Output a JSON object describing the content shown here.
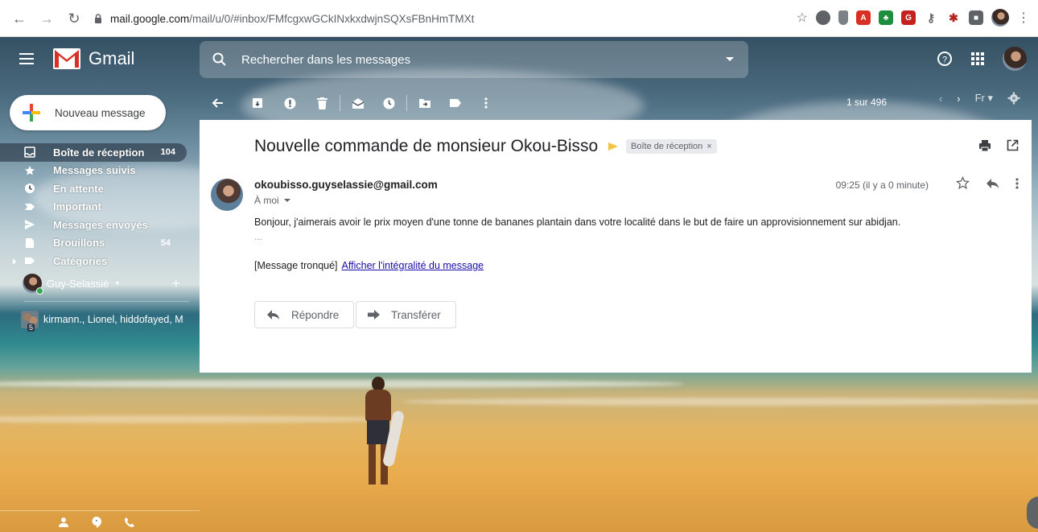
{
  "browser": {
    "url_host": "mail.google.com",
    "url_path": "/mail/u/0/#inbox/FMfcgxwGCkINxkxdwjnSQXsFBnHmTMXt"
  },
  "gmail": {
    "logo_text": "Gmail",
    "search_placeholder": "Rechercher dans les messages"
  },
  "sidebar": {
    "compose_label": "Nouveau message",
    "items": [
      {
        "label": "Boîte de réception",
        "count": "104",
        "icon": "inbox-icon"
      },
      {
        "label": "Messages suivis",
        "count": "",
        "icon": "star-icon"
      },
      {
        "label": "En attente",
        "count": "",
        "icon": "clock-icon"
      },
      {
        "label": "Important",
        "count": "",
        "icon": "important-icon"
      },
      {
        "label": "Messages envoyés",
        "count": "",
        "icon": "send-icon"
      },
      {
        "label": "Brouillons",
        "count": "54",
        "icon": "draft-icon"
      },
      {
        "label": "Catégories",
        "count": "",
        "icon": "label-icon"
      }
    ],
    "hangouts_user": "Guy-Selassié",
    "hangouts_group": "kirmann., Lionel, hiddofayed, M",
    "hangouts_group_count": "5"
  },
  "toolbar": {
    "pager": "1 sur 496",
    "lang": "Fr"
  },
  "message": {
    "subject": "Nouvelle commande de monsieur Okou-Bisso",
    "label_chip": "Boîte de réception",
    "label_chip_close": "×",
    "sender": "okoubisso.guyselassie@gmail.com",
    "to": "À moi",
    "time": "09:25 (il y a 0 minute)",
    "body": "Bonjour, j'aimerais avoir le prix moyen d'une tonne de bananes plantain dans votre localité dans le but de faire un approvisionnement sur abidjan.",
    "ellipsis": "...",
    "truncated": "[Message tronqué]",
    "show_full": "Afficher l'intégralité du message",
    "reply_label": "Répondre",
    "forward_label": "Transférer"
  },
  "colors": {
    "accent_blue": "#1a73e8",
    "important_yellow": "#f4c542",
    "link": "#1a0dab"
  }
}
